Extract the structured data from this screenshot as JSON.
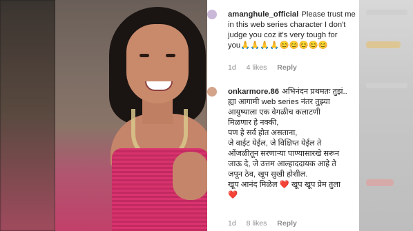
{
  "comments": [
    {
      "username": "amanghule_official",
      "lines": [
        "Please trust me",
        "in this web series character I don't",
        "judge you coz it's very tough for",
        "you🙏🙏🙏🙏😊😊😊😊😊"
      ],
      "time": "1d",
      "likes": "4 likes",
      "reply": "Reply"
    },
    {
      "username": "onkarmore.86",
      "lines": [
        "अभिनंदन प्रथमतः तुझं..",
        "ह्या आगामी web series नंतर तुझ्या",
        "आयुष्याला एक वेगळीच कलाटणी",
        "मिळणार हे नक्की,",
        "पण हे सर्व होत असताना,",
        "जे वाईट येईल, जे विक्षिप्त येईल ते",
        "ओंजळीतून सरणाऱ्या पाण्यासारखे सरून",
        "जाऊ दे, जे उत्तम आल्हाददायक आहे ते",
        "जपून ठेव, खूप सुखी होशील.",
        "खूप आनंद मिळेल ❤️ खूप खूप प्रेम तुला",
        "❤️"
      ],
      "time": "1d",
      "likes": "8 likes",
      "reply": "Reply"
    }
  ]
}
